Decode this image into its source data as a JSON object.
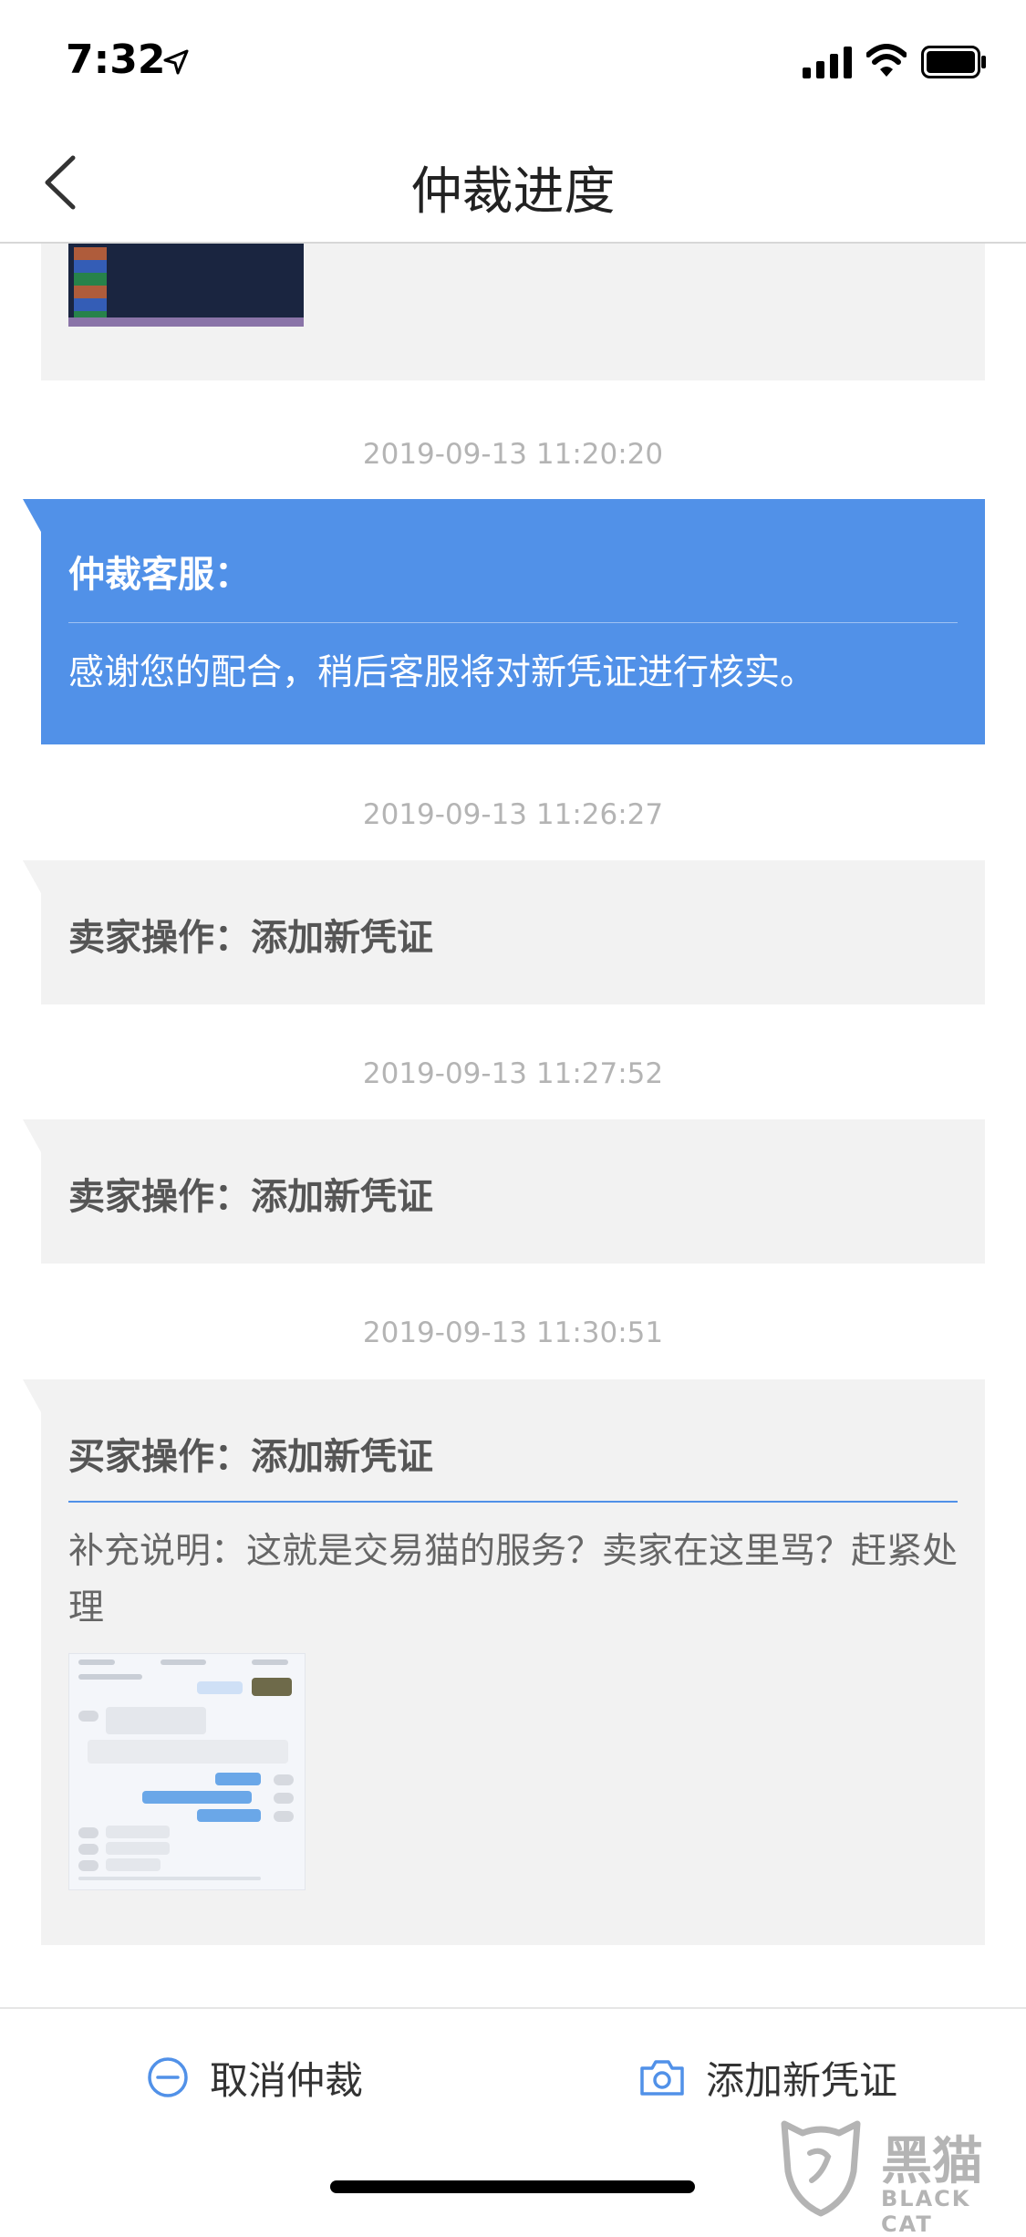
{
  "status_bar": {
    "time": "7:32"
  },
  "nav": {
    "title": "仲裁进度"
  },
  "timeline": [
    {
      "timestamp": "2019-09-13 11:20:20",
      "sender": "仲裁客服：",
      "message": "感谢您的配合，稍后客服将对新凭证进行核实。"
    },
    {
      "timestamp": "2019-09-13 11:26:27",
      "sender": "卖家操作：添加新凭证"
    },
    {
      "timestamp": "2019-09-13 11:27:52",
      "sender": "卖家操作：添加新凭证"
    },
    {
      "timestamp": "2019-09-13 11:30:51",
      "sender": "买家操作：添加新凭证",
      "message": "补充说明：这就是交易猫的服务？卖家在这里骂？赶紧处理"
    }
  ],
  "bottom_bar": {
    "cancel_label": "取消仲裁",
    "add_label": "添加新凭证"
  },
  "watermark": {
    "text": "黑猫",
    "sub": "BLACK CAT"
  },
  "colors": {
    "accent": "#5191e8",
    "card_bg": "#f2f2f2",
    "timestamp": "#b4b4b4"
  }
}
